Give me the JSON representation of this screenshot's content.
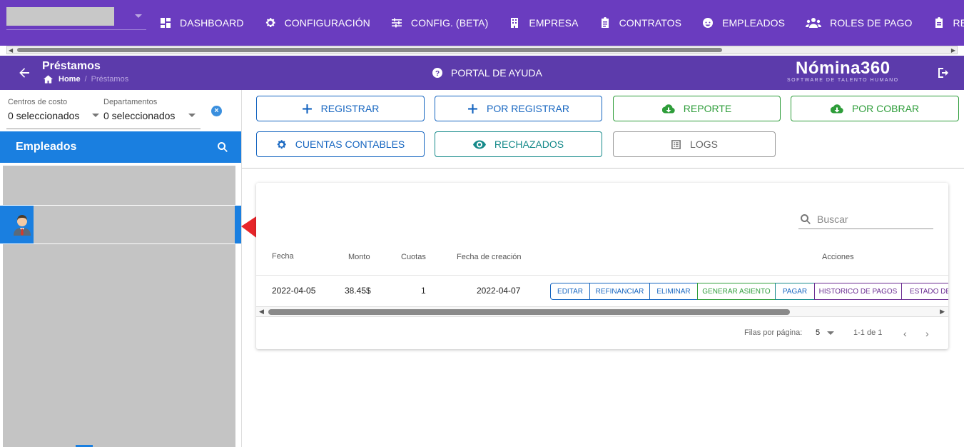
{
  "topnav": {
    "items": [
      {
        "label": "DASHBOARD",
        "icon": "dashboard-icon"
      },
      {
        "label": "CONFIGURACIÓN",
        "icon": "gear-icon"
      },
      {
        "label": "CONFIG. (BETA)",
        "icon": "sliders-icon"
      },
      {
        "label": "EMPRESA",
        "icon": "building-icon"
      },
      {
        "label": "CONTRATOS",
        "icon": "clipboard-icon"
      },
      {
        "label": "EMPLEADOS",
        "icon": "face-icon"
      },
      {
        "label": "ROLES DE PAGO",
        "icon": "users-icon"
      },
      {
        "label": "REPORTES",
        "icon": "report-icon"
      }
    ]
  },
  "header": {
    "title": "Préstamos",
    "breadcrumb": {
      "home": "Home",
      "sep": "/",
      "current": "Préstamos"
    },
    "help": "PORTAL DE AYUDA",
    "logo": {
      "name": "Nómina360",
      "tagline": "SOFTWARE DE TALENTO HUMANO"
    }
  },
  "filters": {
    "cost_centers": {
      "label": "Centros de costo",
      "value": "0 seleccionados"
    },
    "departments": {
      "label": "Departamentos",
      "value": "0 seleccionados"
    }
  },
  "employees": {
    "title": "Empleados"
  },
  "actions": {
    "registrar": "REGISTRAR",
    "por_registrar": "POR REGISTRAR",
    "reporte": "REPORTE",
    "por_cobrar": "POR COBRAR",
    "cuentas": "CUENTAS CONTABLES",
    "rechazados": "RECHAZADOS",
    "logs": "LOGS"
  },
  "table": {
    "search_placeholder": "Buscar",
    "headers": {
      "fecha": "Fecha",
      "monto": "Monto",
      "cuotas": "Cuotas",
      "creacion": "Fecha de creación",
      "acciones": "Acciones"
    },
    "row": {
      "fecha": "2022-04-05",
      "monto": "38.45$",
      "cuotas": "1",
      "creacion": "2022-04-07"
    },
    "row_actions": {
      "editar": "EDITAR",
      "refinanciar": "REFINANCIAR",
      "eliminar": "ELIMINAR",
      "asiento": "GENERAR ASIENTO",
      "pagar": "PAGAR",
      "historico": "HISTORICO DE PAGOS",
      "estado": "ESTADO DE"
    },
    "pagination": {
      "rows_label": "Filas por página:",
      "rows_value": "5",
      "range": "1-1 de 1"
    }
  },
  "colors": {
    "nav_bg": "#6a3cbf",
    "primary_blue": "#1a7fe0",
    "green": "#2e9d3a",
    "arrow_red": "#e8252a"
  }
}
